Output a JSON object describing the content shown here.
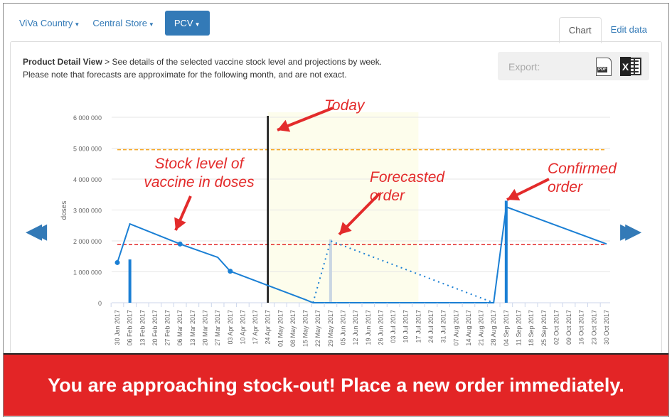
{
  "nav": {
    "country": "ViVa Country",
    "store": "Central Store",
    "product": "PCV"
  },
  "tabs": [
    {
      "label": "Chart",
      "active": true
    },
    {
      "label": "Edit data",
      "active": false
    }
  ],
  "description": {
    "title": "Product Detail View",
    "line1": " > See details of the selected vaccine stock level and projections by week.",
    "line2": "Please note that forecasts are approximate for the following month, and are not exact."
  },
  "export": {
    "label": "Export:",
    "pdf_icon": "PDF",
    "excel_icon": "X"
  },
  "annotations": {
    "today": "Today",
    "stock": "Stock level of vaccine in doses",
    "forecast": "Forecasted order",
    "confirmed": "Confirmed order"
  },
  "banner": "You are approaching stock-out! Place a new order immediately.",
  "colors": {
    "accent": "#337ab7",
    "series": "#1a7fd4",
    "min_line": "#e32b2b",
    "max_line": "#f5a623",
    "forecast_band": "#fdfdec",
    "banner": "#e32526"
  },
  "chart_data": {
    "type": "line",
    "ylabel": "doses",
    "ylim": [
      0,
      6000000
    ],
    "yticks": [
      "0",
      "1 000 000",
      "2 000 000",
      "3 000 000",
      "4 000 000",
      "5 000 000",
      "6 000 000"
    ],
    "categories": [
      "30 Jan 2017",
      "06 Feb 2017",
      "13 Feb 2017",
      "20 Feb 2017",
      "27 Feb 2017",
      "06 Mar 2017",
      "13 Mar 2017",
      "20 Mar 2017",
      "27 Mar 2017",
      "03 Apr 2017",
      "10 Apr 2017",
      "17 Apr 2017",
      "24 Apr 2017",
      "01 May 2017",
      "08 May 2017",
      "15 May 2017",
      "22 May 2017",
      "29 May 2017",
      "05 Jun 2017",
      "12 Jun 2017",
      "19 Jun 2017",
      "26 Jun 2017",
      "03 Jul 2017",
      "10 Jul 2017",
      "17 Jul 2017",
      "24 Jul 2017",
      "31 Jul 2017",
      "07 Aug 2017",
      "14 Aug 2017",
      "21 Aug 2017",
      "28 Aug 2017",
      "04 Sep 2017",
      "11 Sep 2017",
      "18 Sep 2017",
      "25 Sep 2017",
      "02 Oct 2017",
      "09 Oct 2017",
      "16 Oct 2017",
      "23 Oct 2017",
      "30 Oct 2017"
    ],
    "today": "24 Apr 2017",
    "forecast_band": [
      "24 Apr 2017",
      "17 Jul 2017"
    ],
    "max_stock": 4950000,
    "min_stock": 1880000,
    "stock": [
      [
        0,
        1300000
      ],
      [
        1,
        2550000
      ],
      [
        5,
        1900000
      ],
      [
        8,
        1470000
      ],
      [
        9,
        1020000
      ],
      [
        15,
        100000
      ],
      [
        15.6,
        0
      ],
      [
        30,
        0
      ],
      [
        31,
        3100000
      ],
      [
        39,
        1900000
      ]
    ],
    "stock_markers": [
      [
        0,
        1300000
      ],
      [
        5,
        1900000
      ],
      [
        9,
        1020000
      ]
    ],
    "forecast_stock": [
      [
        15.6,
        0
      ],
      [
        17,
        2000000
      ],
      [
        30,
        0
      ]
    ],
    "shipments": [
      {
        "index": 1,
        "value": 1400000,
        "type": "past"
      },
      {
        "index": 17,
        "value": 2050000,
        "type": "forecast"
      },
      {
        "index": 31,
        "value": 3300000,
        "type": "confirmed"
      }
    ]
  }
}
